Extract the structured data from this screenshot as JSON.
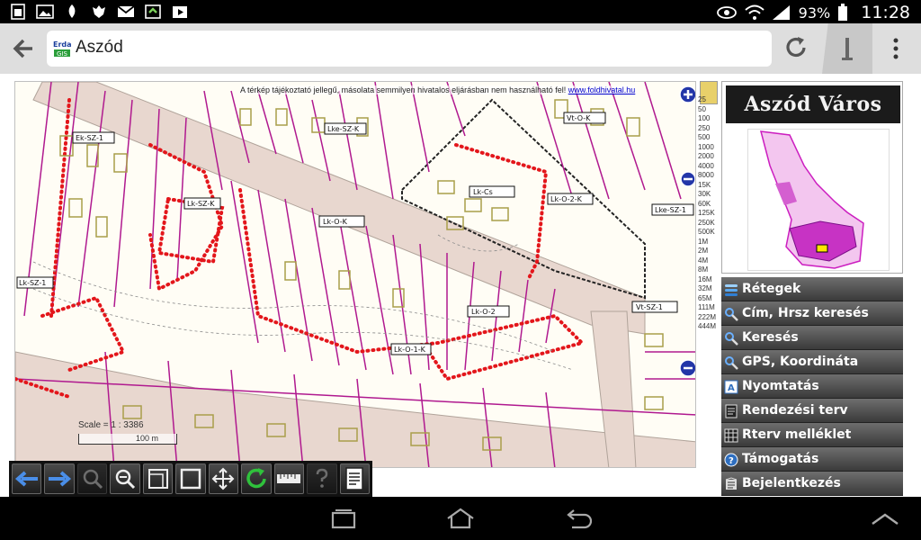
{
  "status_bar": {
    "battery": "93%",
    "clock": "11:28"
  },
  "browser": {
    "tab_title": "Aszód",
    "favicon_text": "Erda GIS"
  },
  "map": {
    "disclaimer": "A térkép tájékoztató jellegű, másolata semmilyen hivatalos eljárásban nem használható fel!",
    "disclaimer_link": "www.foldhivatal.hu",
    "scale_text": "Scale = 1 : 3386",
    "scale_bar_label": "100 m",
    "zoom_levels": [
      "25",
      "50",
      "100",
      "250",
      "500",
      "1000",
      "2000",
      "4000",
      "8000",
      "15K",
      "30K",
      "60K",
      "125K",
      "250K",
      "500K",
      "1M",
      "2M",
      "4M",
      "8M",
      "16M",
      "32M",
      "65M",
      "111M",
      "222M",
      "444M"
    ],
    "zone_labels": [
      "Lk-Cs",
      "Lk-O-2-K",
      "Vt-SZ-1",
      "Lk-SZ-K",
      "Lk-O-K",
      "Lk-O-2",
      "Lke-SZ-K",
      "Vt-O-K",
      "Lke-SZ-1",
      "Ek-SZ-1",
      "Lk-O-1-K",
      "Lk-SZ-1"
    ]
  },
  "sidebar": {
    "logo_text": "Aszód Város",
    "menu": [
      {
        "label": "Rétegek",
        "icon": "layers-icon"
      },
      {
        "label": "Cím, Hrsz keresés",
        "icon": "magnifier-icon"
      },
      {
        "label": "Keresés",
        "icon": "magnifier-icon"
      },
      {
        "label": "GPS, Koordináta",
        "icon": "magnifier-icon"
      },
      {
        "label": "Nyomtatás",
        "icon": "print-icon"
      },
      {
        "label": "Rendezési terv",
        "icon": "document-icon"
      },
      {
        "label": "Rterv melléklet",
        "icon": "grid-document-icon"
      },
      {
        "label": "Támogatás",
        "icon": "help-icon"
      },
      {
        "label": "Bejelentkezés",
        "icon": "login-icon"
      }
    ]
  },
  "colors": {
    "parcel_line": "#b0198f",
    "boundary_dot": "#e3161b",
    "road_fill": "#e8d7cf",
    "building": "#c9c27a"
  }
}
